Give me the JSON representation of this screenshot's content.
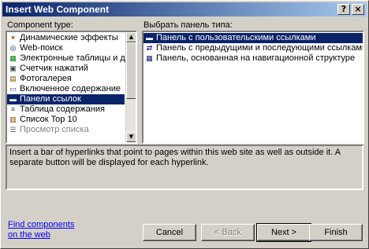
{
  "window": {
    "title": "Insert Web Component",
    "help_glyph": "?",
    "close_glyph": "×"
  },
  "left_panel": {
    "label": "Component type:",
    "items": [
      {
        "label": "Динамические эффекты",
        "icon": "effects-icon"
      },
      {
        "label": "Web-поиск",
        "icon": "search-icon"
      },
      {
        "label": "Электронные таблицы и диаграммы",
        "icon": "spreadsheet-icon"
      },
      {
        "label": "Счетчик нажатий",
        "icon": "hit-counter-icon"
      },
      {
        "label": "Фотогалерея",
        "icon": "photo-gallery-icon"
      },
      {
        "label": "Включенное содержание",
        "icon": "included-content-icon"
      },
      {
        "label": "Панели ссылок",
        "icon": "link-bars-icon"
      },
      {
        "label": "Таблица содержания",
        "icon": "table-of-contents-icon"
      },
      {
        "label": "Список Top 10",
        "icon": "top-ten-icon"
      },
      {
        "label": "Просмотр списка",
        "icon": "list-view-icon"
      }
    ],
    "selected_index": 6
  },
  "right_panel": {
    "label": "Выбрать панель типа:",
    "items": [
      {
        "label": "Панель с пользовательскими ссылками",
        "icon": "custom-links-bar-icon"
      },
      {
        "label": "Панель с предыдущими и последующими ссылками",
        "icon": "back-next-bar-icon"
      },
      {
        "label": "Панель, основанная на навигационной структуре",
        "icon": "nav-structure-bar-icon"
      }
    ],
    "selected_index": 0
  },
  "description": "Insert a bar of hyperlinks that point to pages within this web site as well as outside it.  A separate button will be displayed for each hyperlink.",
  "footer": {
    "find_line1": "Find components",
    "find_line2": "on the web"
  },
  "buttons": {
    "cancel": "Cancel",
    "back": "< Back",
    "next": "Next >",
    "finish": "Finish"
  }
}
